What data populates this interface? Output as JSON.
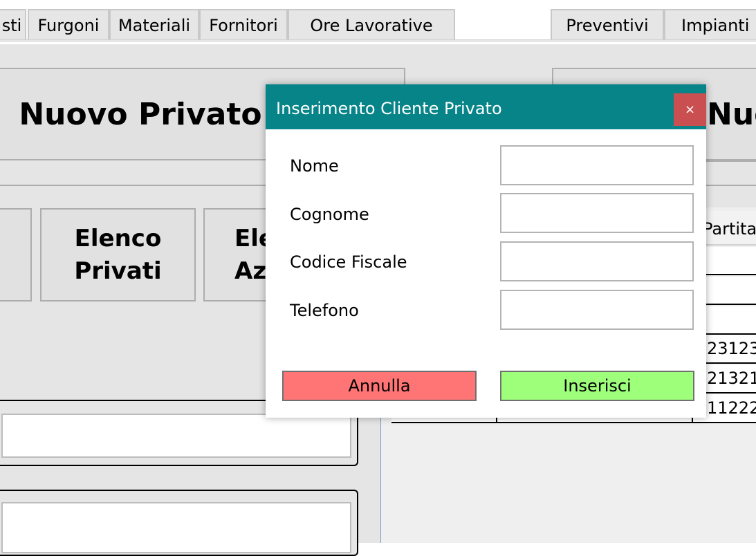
{
  "tabs": [
    "sti",
    "Furgoni",
    "Materiali",
    "Fornitori",
    "Ore Lavorative",
    "Preventivi",
    "Impianti"
  ],
  "background": {
    "left_header_title": "Nuovo Privato",
    "right_header_title": "Nuo",
    "list_button_1": [
      "Elenco",
      "Privati"
    ],
    "list_button_2": [
      "Ele",
      "Azi"
    ],
    "grid_header_partial": "Partital",
    "grid_values": [
      "23123",
      "21321",
      "11222"
    ]
  },
  "dialog": {
    "title": "Inserimento Cliente Privato",
    "close_label": "×",
    "fields": [
      {
        "label": "Nome",
        "value": ""
      },
      {
        "label": "Cognome",
        "value": ""
      },
      {
        "label": "Codice Fiscale",
        "value": ""
      },
      {
        "label": "Telefono",
        "value": ""
      }
    ],
    "cancel_label": "Annulla",
    "submit_label": "Inserisci"
  },
  "colors": {
    "titlebar": "#068488",
    "close": "#c94f50",
    "cancel": "#ff7575",
    "submit": "#9dff7a"
  }
}
